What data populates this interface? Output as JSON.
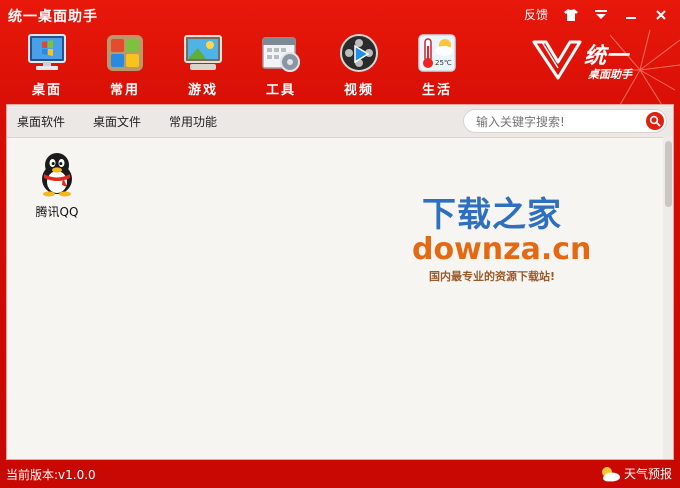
{
  "window": {
    "title": "统一桌面助手",
    "feedback_label": "反馈"
  },
  "toolbar": {
    "items": [
      {
        "label": "桌面",
        "icon": "desktop-monitor-icon"
      },
      {
        "label": "常用",
        "icon": "common-apps-icon"
      },
      {
        "label": "游戏",
        "icon": "game-icon"
      },
      {
        "label": "工具",
        "icon": "tools-calendar-icon"
      },
      {
        "label": "视频",
        "icon": "video-film-icon"
      },
      {
        "label": "生活",
        "icon": "weather-thermometer-icon"
      }
    ],
    "life_icon_temp": "25℃"
  },
  "brand": {
    "name": "统一",
    "sub": "桌面助手"
  },
  "tabs": [
    {
      "label": "桌面软件",
      "active": true
    },
    {
      "label": "桌面文件",
      "active": false
    },
    {
      "label": "常用功能",
      "active": false
    }
  ],
  "search": {
    "placeholder": "输入关键字搜索!"
  },
  "items": [
    {
      "label": "腾讯QQ",
      "icon": "qq-penguin-icon"
    }
  ],
  "watermark": {
    "line1": "下载之家",
    "line2": "downza.cn",
    "line3": "国内最专业的资源下载站!"
  },
  "status": {
    "version": "当前版本:v1.0.0",
    "weather_label": "天气预报"
  },
  "colors": {
    "accent_red": "#d40d05",
    "content_bg": "#f7f5f2"
  }
}
